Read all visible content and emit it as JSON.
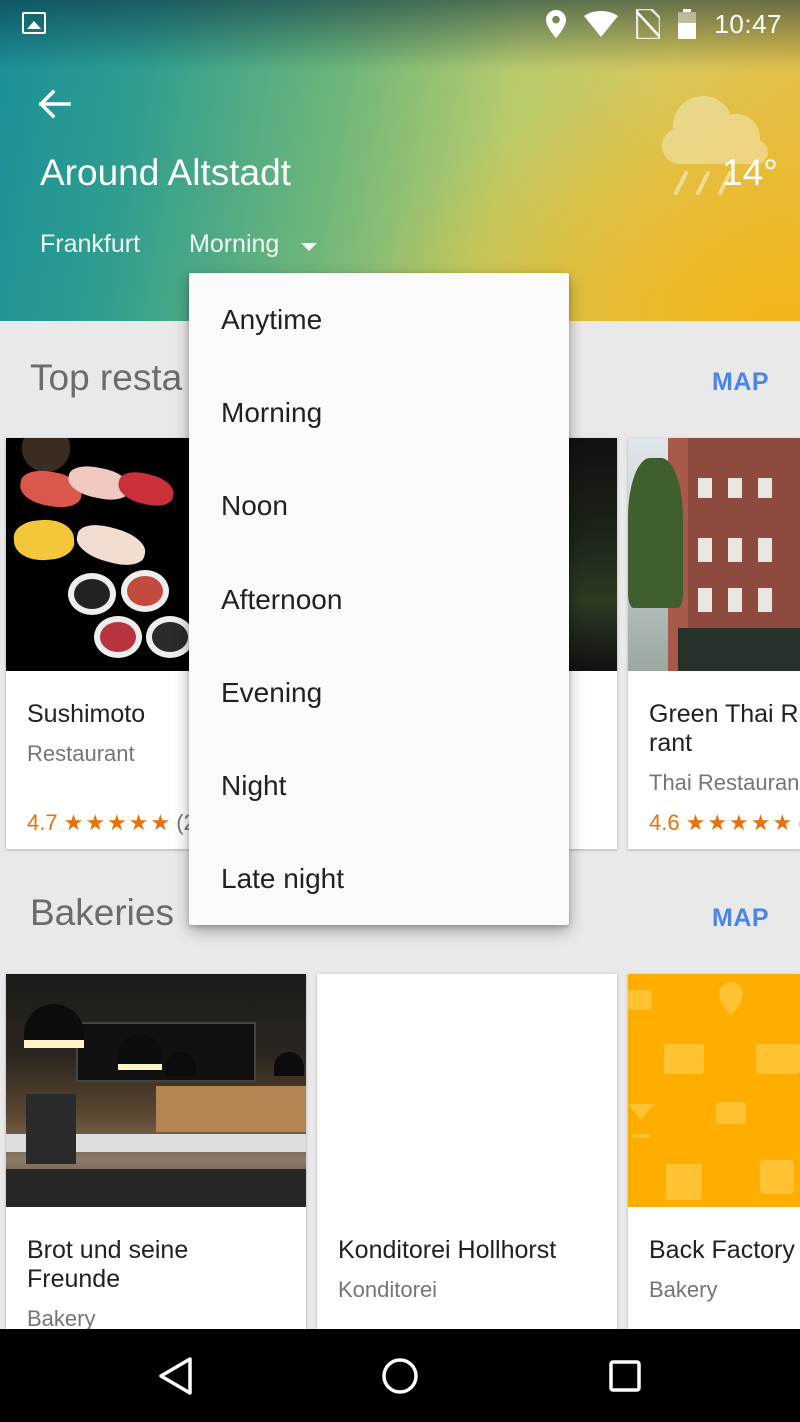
{
  "status_bar": {
    "time": "10:47",
    "icons": [
      "image-icon",
      "location-icon",
      "wifi-icon",
      "no-sim-icon",
      "battery-icon"
    ]
  },
  "header": {
    "title": "Around Altstadt",
    "temperature": "14°",
    "weather_icon": "rain-cloud-icon",
    "location": "Frankfurt",
    "time_filter": "Morning"
  },
  "dropdown": {
    "options": [
      "Anytime",
      "Morning",
      "Noon",
      "Afternoon",
      "Evening",
      "Night",
      "Late night"
    ]
  },
  "sections": [
    {
      "title": "Top resta",
      "map_label": "MAP",
      "cards": [
        {
          "name": "Sushimoto",
          "category": "Restaurant",
          "rating": "4.7",
          "stars": 4.7,
          "reviews": "(2"
        },
        {
          "name": "",
          "category": "",
          "rating": "",
          "stars": 0,
          "reviews": ""
        },
        {
          "name": "Green Thai R",
          "name_line2": "rant",
          "category": "Thai Restauran",
          "rating": "4.6",
          "stars": 4.6,
          "reviews": "("
        }
      ]
    },
    {
      "title": "Bakeries",
      "map_label": "MAP",
      "cards": [
        {
          "name": "Brot und seine",
          "name_line2": "Freunde",
          "category": "Bakery"
        },
        {
          "name": "Konditorei Hollhorst",
          "category": "Konditorei"
        },
        {
          "name": "Back Factory",
          "category": "Bakery"
        }
      ]
    }
  ],
  "colors": {
    "accent_blue": "#4a85e8",
    "rating_orange": "#e8710a",
    "placeholder_orange": "#ffae00"
  }
}
